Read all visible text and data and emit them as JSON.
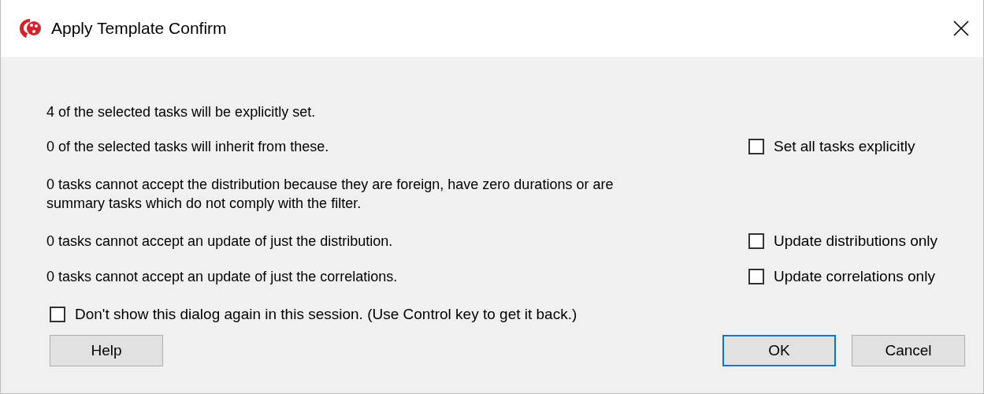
{
  "window": {
    "title": "Apply Template Confirm"
  },
  "rows": [
    {
      "message": "4 of the selected tasks will be explicitly set."
    },
    {
      "message": "0 of the selected tasks will inherit from these.",
      "checkbox": {
        "label": "Set all tasks explicitly",
        "checked": false
      }
    },
    {
      "message": "0 tasks cannot accept the distribution because they are foreign, have zero durations or are summary tasks which do not comply with the filter."
    },
    {
      "message": "0 tasks cannot accept an update of just the distribution.",
      "checkbox": {
        "label": "Update distributions only",
        "checked": false
      }
    },
    {
      "message": "0 tasks cannot accept an update of just the correlations.",
      "checkbox": {
        "label": "Update correlations only",
        "checked": false
      }
    }
  ],
  "dont_show": {
    "label": "Don't show this dialog again in this session. (Use Control key to get it back.)",
    "checked": false
  },
  "buttons": [
    {
      "label": "Help",
      "default": false
    },
    {
      "label": "OK",
      "default": true
    },
    {
      "label": "Cancel",
      "default": false
    }
  ]
}
